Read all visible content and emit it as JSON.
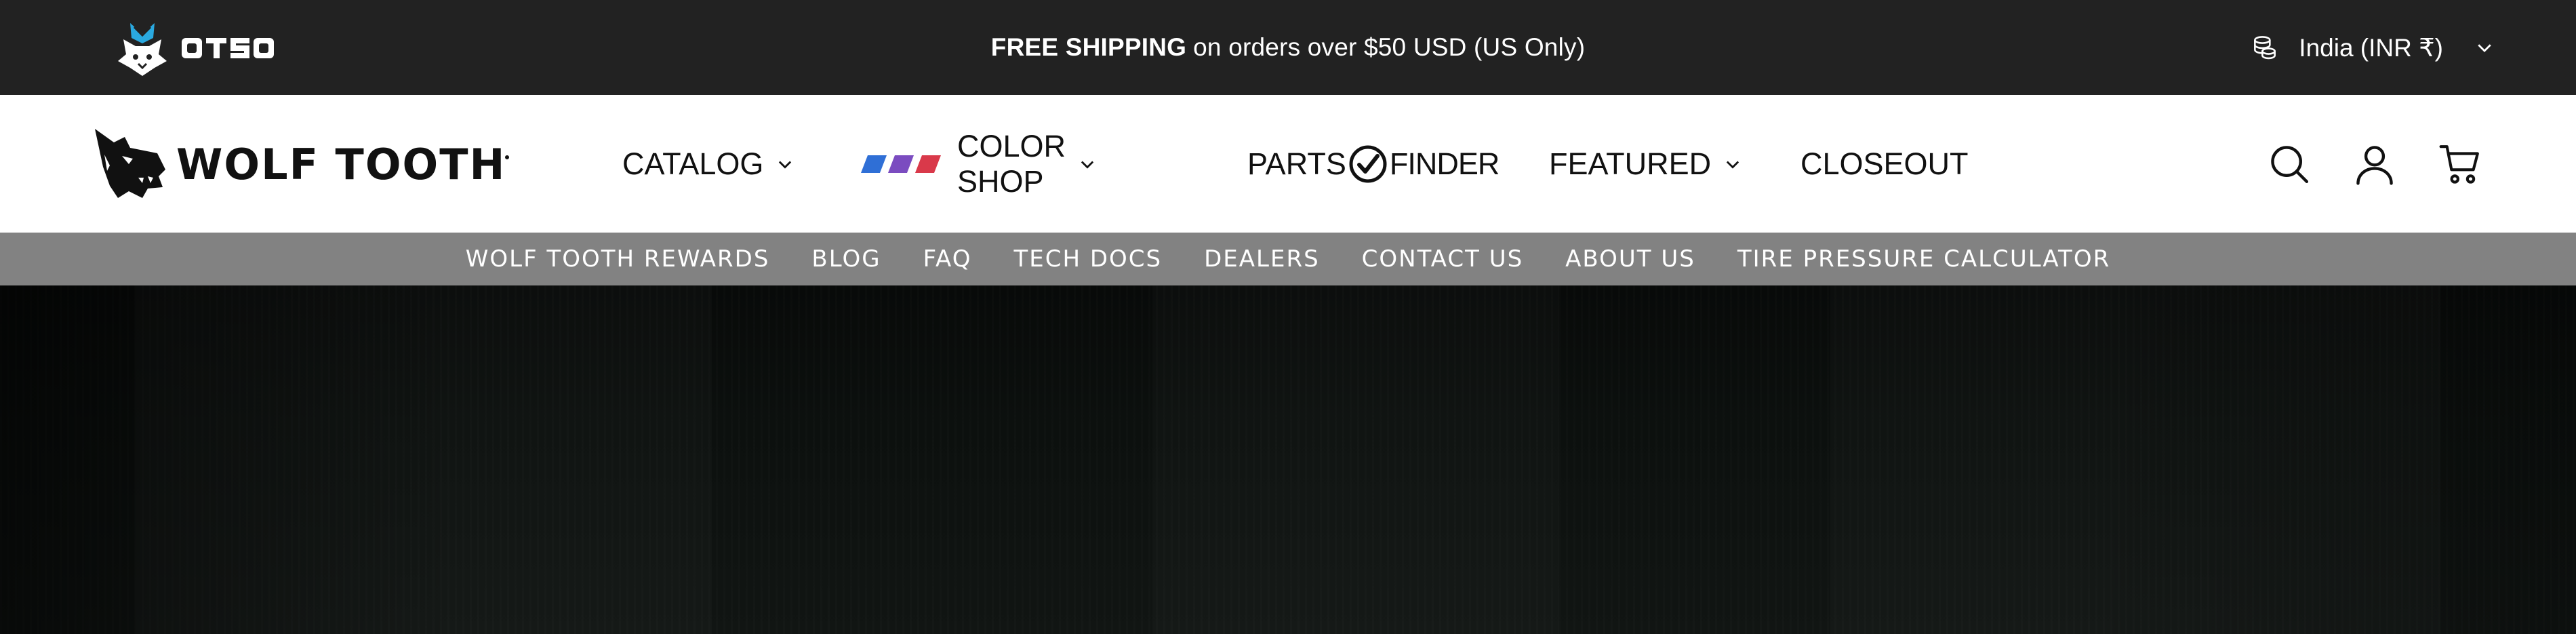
{
  "announcement": {
    "bold_text": "FREE SHIPPING",
    "text": "on orders over $50 USD (US Only)"
  },
  "otso": {
    "logo_text": "OTSO",
    "icon": "otso-fox-logo"
  },
  "currency": {
    "label": "India (INR ₹)",
    "icon": "coins-icon"
  },
  "brand": {
    "logo_text": "WOLF TOOTH",
    "icon": "wolf-head-logo"
  },
  "main_nav": {
    "catalog": "CATALOG",
    "color_shop": "COLOR SHOP",
    "parts": "PARTS",
    "finder": "FINDER",
    "featured": "FEATURED",
    "closeout": "CLOSEOUT",
    "stripe_colors": [
      "#2f6fd6",
      "#7b4cc0",
      "#d9394a"
    ]
  },
  "header_icons": [
    "search-icon",
    "account-icon",
    "cart-icon"
  ],
  "sub_nav": {
    "items": [
      "WOLF TOOTH REWARDS",
      "BLOG",
      "FAQ",
      "TECH DOCS",
      "DEALERS",
      "CONTACT US",
      "ABOUT US",
      "TIRE PRESSURE CALCULATOR"
    ]
  },
  "colors": {
    "topbar_bg": "#222222",
    "header_bg": "#ffffff",
    "subnav_bg": "#828282",
    "otso_accent": "#2aa9e0"
  }
}
